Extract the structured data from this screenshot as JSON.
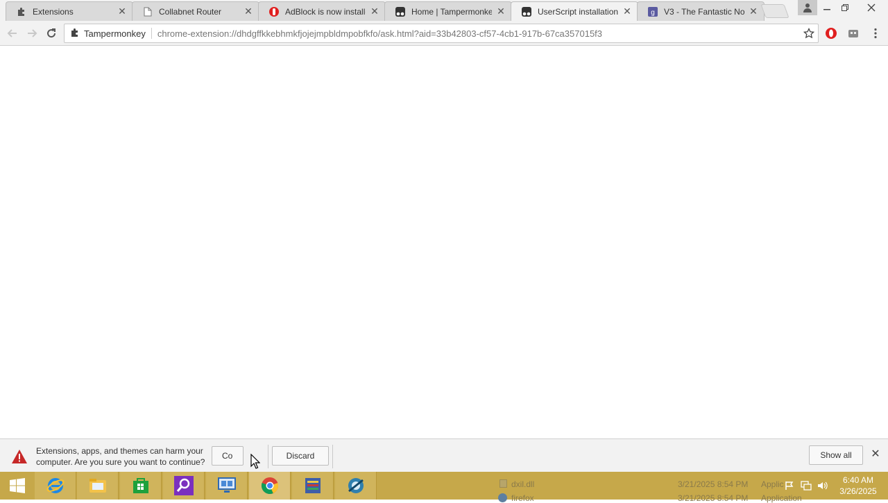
{
  "browser": {
    "tabs": [
      {
        "title": "Extensions",
        "favicon": "puzzle-icon",
        "active": false
      },
      {
        "title": "Collabnet Router",
        "favicon": "page-icon",
        "active": false
      },
      {
        "title": "AdBlock is now installe",
        "favicon": "adblock-icon",
        "active": false
      },
      {
        "title": "Home | Tampermonke",
        "favicon": "tampermonkey-icon",
        "active": false
      },
      {
        "title": "UserScript installation",
        "favicon": "tampermonkey-icon",
        "active": true
      },
      {
        "title": "V3 - The Fantastic No",
        "favicon": "v3-icon",
        "active": false
      }
    ],
    "omnibox": {
      "extension_name": "Tampermonkey",
      "url": "chrome-extension://dhdgffkkebhmkfjojejmpbldmpobfkfo/ask.html?aid=33b42803-cf57-4cb1-917b-67ca357015f3"
    }
  },
  "download_bar": {
    "warning_text": "Extensions, apps, and themes can harm your computer. Are you sure you want to continue?",
    "continue_label": "Co",
    "discard_label": "Discard",
    "show_all_label": "Show all"
  },
  "taskbar": {
    "ghost_items": [
      {
        "name": "dxil.dll",
        "date": "3/21/2025 8:54 PM",
        "type": "Applic"
      },
      {
        "name": "firefox",
        "date": "3/21/2025 8:54 PM",
        "type": "Application"
      }
    ],
    "clock": {
      "time": "6:40 AM",
      "date": "3/26/2025"
    }
  },
  "colors": {
    "taskbar": "#c6a84a",
    "warning": "#c62828",
    "accent": "#4285f4"
  }
}
